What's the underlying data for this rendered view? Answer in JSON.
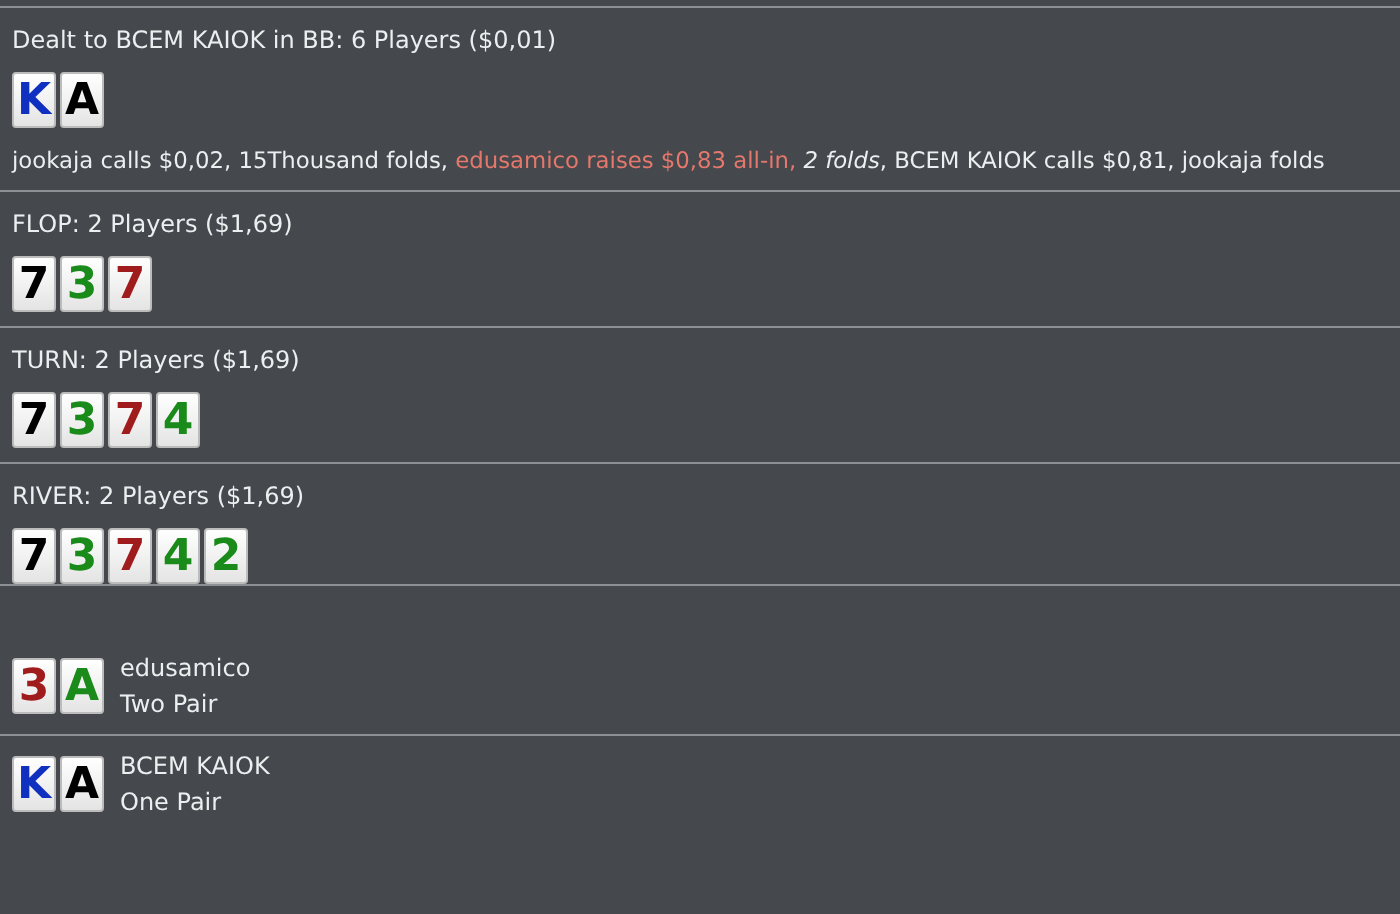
{
  "sections": [
    {
      "header": "Dealt to BCEM KAIOK in BB: 6 Players ($0,01)",
      "cards": [
        {
          "rank": "K",
          "color": "#1030c0"
        },
        {
          "rank": "A",
          "color": "#000000"
        }
      ],
      "actions": [
        {
          "kind": "plain",
          "text": "jookaja calls $0,02, 15Thousand folds, "
        },
        {
          "kind": "raise",
          "text": "edusamico raises $0,83 all-in,"
        },
        {
          "kind": "italic",
          "text": " 2 folds"
        },
        {
          "kind": "plain",
          "text": ", BCEM KAIOK calls $0,81, jookaja folds"
        }
      ]
    },
    {
      "header": "FLOP: 2 Players ($1,69)",
      "cards": [
        {
          "rank": "7",
          "color": "#000000"
        },
        {
          "rank": "3",
          "color": "#1a8a1a"
        },
        {
          "rank": "7",
          "color": "#a01c1c"
        }
      ]
    },
    {
      "header": "TURN: 2 Players ($1,69)",
      "cards": [
        {
          "rank": "7",
          "color": "#000000"
        },
        {
          "rank": "3",
          "color": "#1a8a1a"
        },
        {
          "rank": "7",
          "color": "#a01c1c"
        },
        {
          "rank": "4",
          "color": "#1a8a1a"
        }
      ]
    },
    {
      "header": "RIVER: 2 Players ($1,69)",
      "cards": [
        {
          "rank": "7",
          "color": "#000000"
        },
        {
          "rank": "3",
          "color": "#1a8a1a"
        },
        {
          "rank": "7",
          "color": "#a01c1c"
        },
        {
          "rank": "4",
          "color": "#1a8a1a"
        },
        {
          "rank": "2",
          "color": "#1a8a1a"
        }
      ]
    }
  ],
  "showdown": [
    {
      "player": "edusamico",
      "hand": "Two Pair",
      "cards": [
        {
          "rank": "3",
          "color": "#a01c1c"
        },
        {
          "rank": "A",
          "color": "#1a8a1a"
        }
      ]
    },
    {
      "player": "BCEM KAIOK",
      "hand": "One Pair",
      "cards": [
        {
          "rank": "K",
          "color": "#1030c0"
        },
        {
          "rank": "A",
          "color": "#000000"
        }
      ]
    }
  ]
}
